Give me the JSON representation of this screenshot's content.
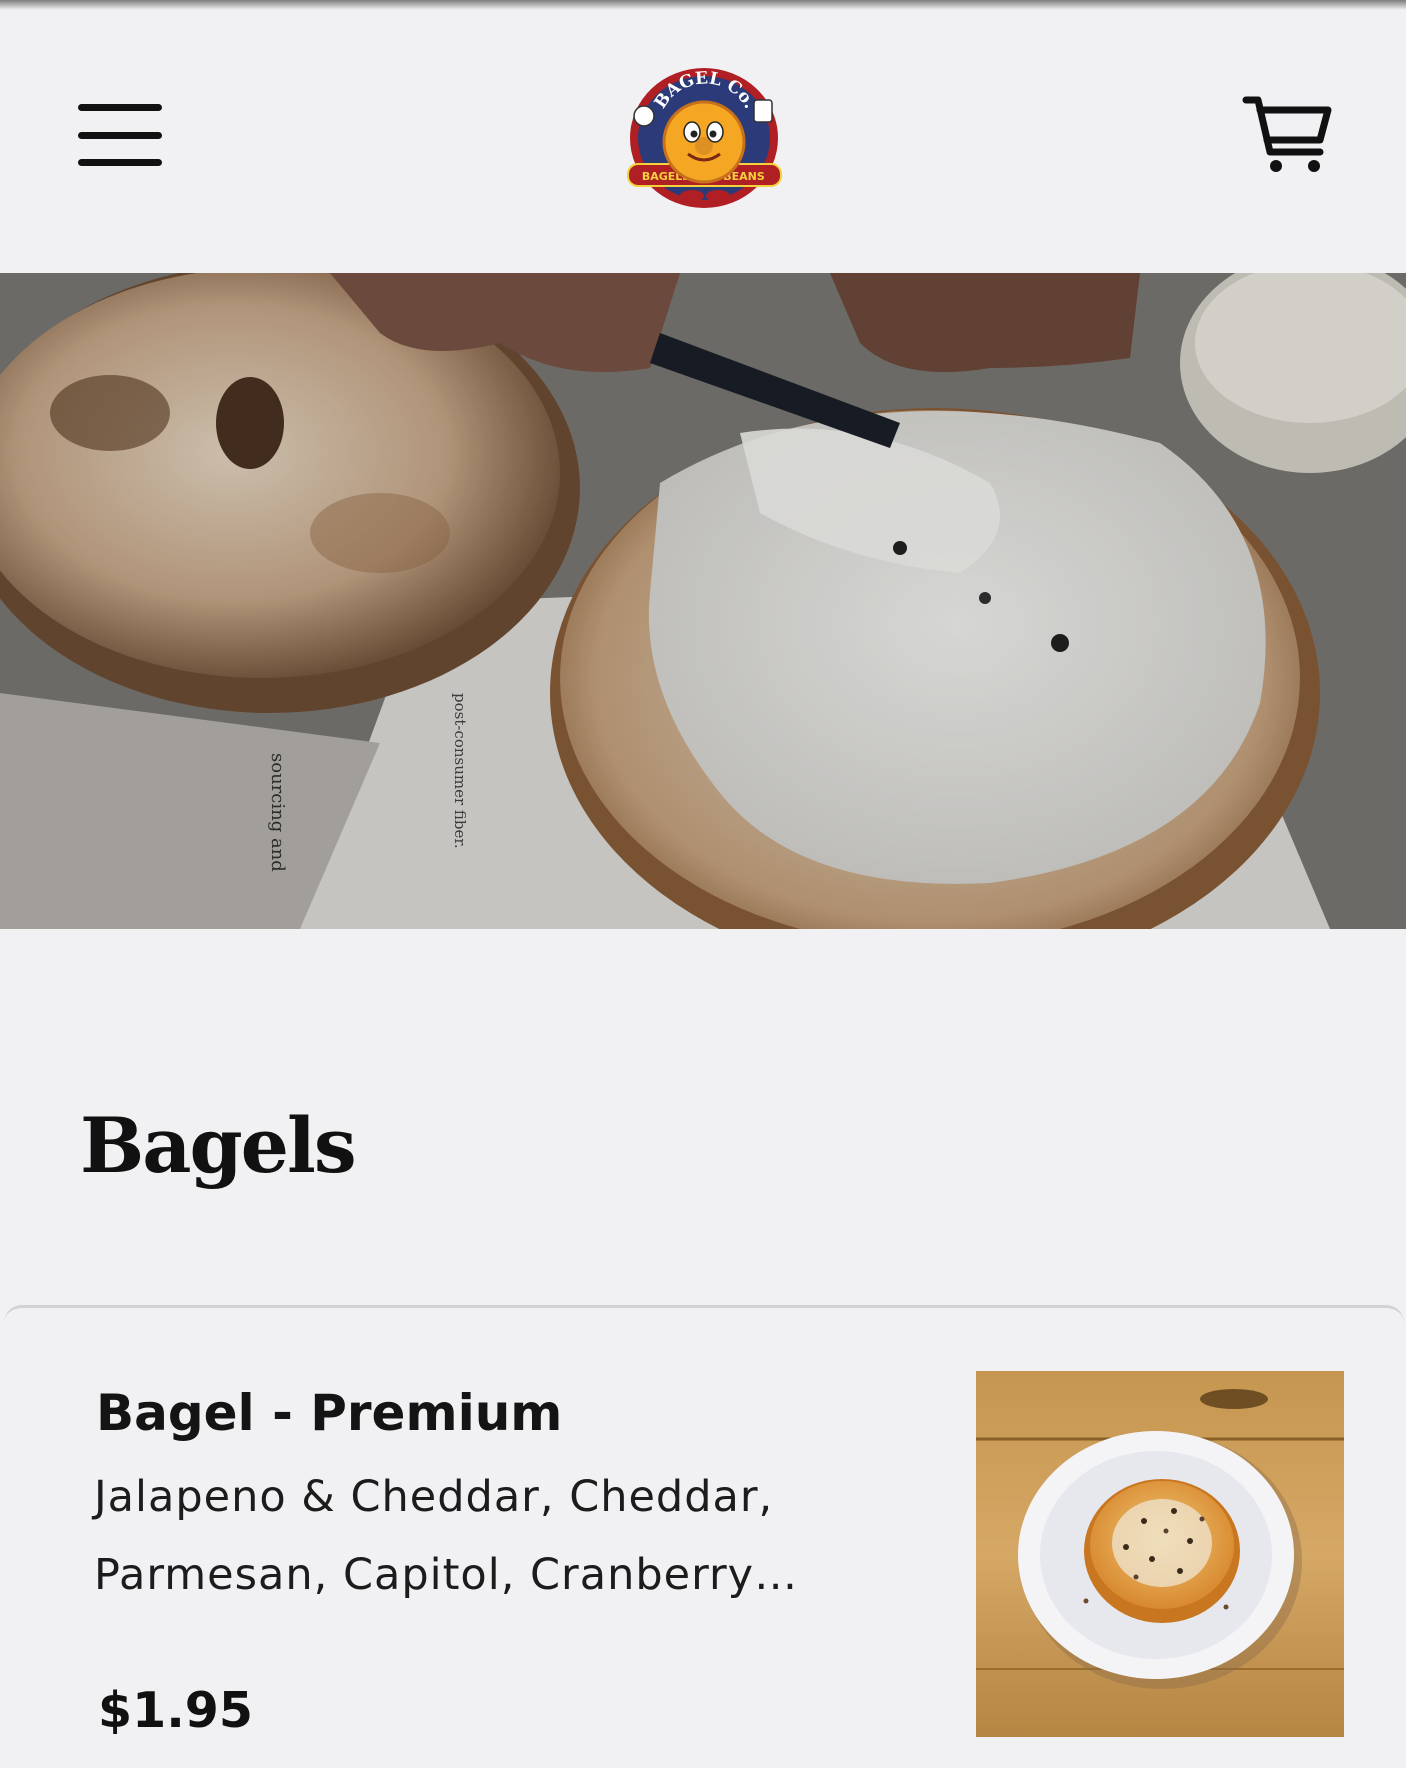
{
  "header": {
    "menu_icon": "hamburger-menu-icon",
    "logo_alt": "The Bagel Co. - Bagels & Beans",
    "logo_text_top": "BAGEL Co.",
    "logo_text_bottom_left": "BAGELS",
    "logo_text_bottom_right": "BEANS",
    "cart_icon": "shopping-cart-icon"
  },
  "hero": {
    "alt": "Hands spreading cream cheese on a toasted bagel",
    "paper_text_1": "post-consumer fiber.",
    "paper_text_2": "sourcing and"
  },
  "section": {
    "title": "Bagels"
  },
  "items": [
    {
      "name": "Bagel - Premium",
      "description": "Jalapeno & Cheddar, Cheddar, Parmesan, Capitol, Cranberry…",
      "price": "$1.95",
      "image_alt": "Everything bagel on a white plate"
    }
  ],
  "colors": {
    "background": "#f1f1f3",
    "text": "#111111",
    "divider": "#d2d2d6",
    "logo_red": "#b01f24",
    "logo_navy": "#2b3a78",
    "logo_orange": "#f5a623"
  }
}
